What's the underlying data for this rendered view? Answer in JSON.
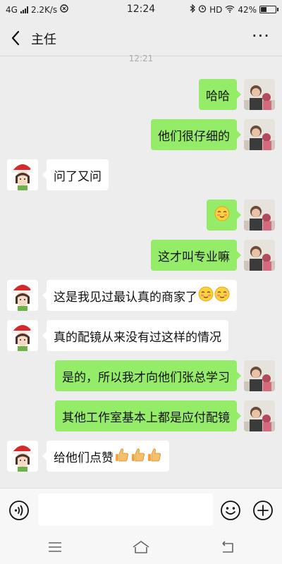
{
  "status_bar": {
    "network": "4G",
    "speed": "2.2K/s",
    "time": "12:24",
    "hd": "HD",
    "battery": "42%",
    "battery_level": 0.42
  },
  "header": {
    "title": "主任",
    "more": "···"
  },
  "chat": {
    "timestamp": "12:21",
    "messages": [
      {
        "side": "out",
        "text": "哈哈",
        "emoji": []
      },
      {
        "side": "out",
        "text": "他们很仔细的",
        "emoji": []
      },
      {
        "side": "in",
        "text": "问了又问",
        "emoji": []
      },
      {
        "side": "out",
        "text": "",
        "emoji": [
          "blush-emoji"
        ]
      },
      {
        "side": "out",
        "text": "这才叫专业嘛",
        "emoji": []
      },
      {
        "side": "in",
        "text": "这是我见过最认真的商家了",
        "emoji": [
          "blush-emoji",
          "blush-emoji"
        ]
      },
      {
        "side": "in",
        "text": "真的配镜从来没有过这样的情况",
        "emoji": []
      },
      {
        "side": "out",
        "text": "是的，所以我才向他们张总学习",
        "emoji": []
      },
      {
        "side": "out",
        "text": "其他工作室基本上都是应付配镜",
        "emoji": []
      },
      {
        "side": "in",
        "text": "给他们点赞",
        "emoji": [
          "thumbs-up-emoji",
          "thumbs-up-emoji",
          "thumbs-up-emoji"
        ]
      }
    ]
  },
  "input_bar": {
    "value": "",
    "placeholder": ""
  },
  "colors": {
    "background": "#ededed",
    "outgoing_bubble": "#95ec69",
    "incoming_bubble": "#ffffff"
  }
}
